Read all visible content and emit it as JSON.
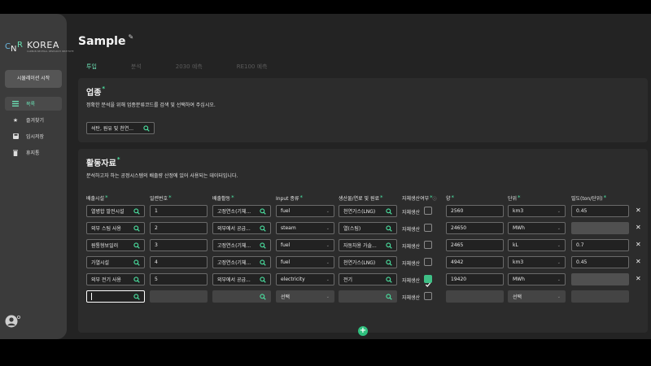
{
  "brand": {
    "name": "KOREA",
    "mark": "CNR",
    "subtitle": "CARBON NEUTRAL RESEARCH INSTITUTE",
    "accent": "#6be2b5"
  },
  "sidebar": {
    "simulate_label": "시뮬레이션 시작",
    "items": [
      {
        "label": "목록",
        "icon": "list-icon"
      },
      {
        "label": "즐겨찾기",
        "icon": "star-icon"
      },
      {
        "label": "임시저장",
        "icon": "save-icon"
      },
      {
        "label": "휴지통",
        "icon": "trash-icon"
      }
    ]
  },
  "page": {
    "title": "Sample"
  },
  "tabs": [
    "투입",
    "분석",
    "2030 예측",
    "RE100 예측"
  ],
  "industry": {
    "title": "업종",
    "required_mark": "*",
    "description": "정확한 분석을 위해 업종분류코드를 검색 및 선택하여 주십시오.",
    "value": "석탄, 원유 및 천연..."
  },
  "activity": {
    "title": "활동자료",
    "required_mark": "*",
    "description": "분석하고자 하는 공정시스템의 배출량 산정에 있어 사용되는 데이터입니다.",
    "columns": [
      "배출시설",
      "일련번호",
      "배출활동",
      "Input 종류",
      "생산물/연료 및 원료",
      "자체생산여부",
      "양",
      "단위",
      "밀도(ton/단위)"
    ],
    "self_label": "자체생산",
    "rows": [
      {
        "facility": "열병합 발전시설",
        "serial": "1",
        "activity": "고정연소(기체...",
        "input": "fuel",
        "product": "천연가스(LNG)",
        "self": false,
        "amount": "2560",
        "unit": "km3",
        "density": "0.45"
      },
      {
        "facility": "외부 스팀 사용",
        "serial": "2",
        "activity": "외부에서 공급...",
        "input": "steam",
        "product": "열(스팀)",
        "self": false,
        "amount": "24650",
        "unit": "MWh",
        "density": ""
      },
      {
        "facility": "원통형보일러",
        "serial": "3",
        "activity": "고정연소(기체...",
        "input": "fuel",
        "product": "자동차용 가솔...",
        "self": false,
        "amount": "2465",
        "unit": "kL",
        "density": "0.7"
      },
      {
        "facility": "가열시설",
        "serial": "4",
        "activity": "고정연소(기체...",
        "input": "fuel",
        "product": "천연가스(LNG)",
        "self": false,
        "amount": "4942",
        "unit": "km3",
        "density": "0.45"
      },
      {
        "facility": "외부 전기 사용",
        "serial": "5",
        "activity": "외부에서 공급...",
        "input": "electricity",
        "product": "전기",
        "self": true,
        "amount": "19420",
        "unit": "MWh",
        "density": ""
      }
    ],
    "new_row": {
      "input": "선택",
      "unit": "선택"
    }
  }
}
